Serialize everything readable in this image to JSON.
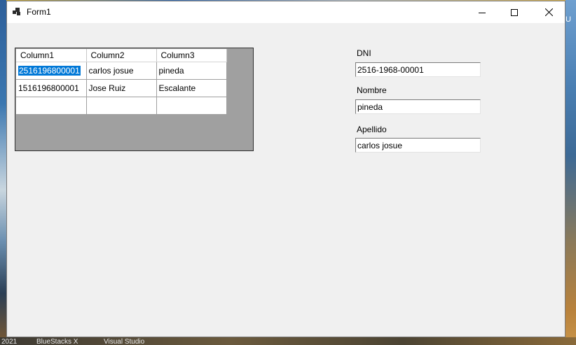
{
  "window": {
    "title": "Form1"
  },
  "grid": {
    "columns": [
      "Column1",
      "Column2",
      "Column3"
    ],
    "rows": [
      [
        "2516196800001",
        "carlos josue",
        "pineda"
      ],
      [
        "1516196800001",
        "Jose Ruiz",
        "Escalante"
      ],
      [
        "",
        "",
        ""
      ]
    ]
  },
  "form": {
    "dni_label": "DNI",
    "dni_value": "2516-1968-00001",
    "nombre_label": "Nombre",
    "nombre_value": "pineda",
    "apellido_label": "Apellido",
    "apellido_value": "carlos josue"
  },
  "background": {
    "taskbar_items": [
      "2021",
      "BlueStacks X",
      "Visual Studio"
    ],
    "right_edge_text": "U"
  },
  "colors": {
    "selection": "#0078d7",
    "window_bg": "#f0f0f0",
    "grid_bg": "#a0a0a0"
  }
}
